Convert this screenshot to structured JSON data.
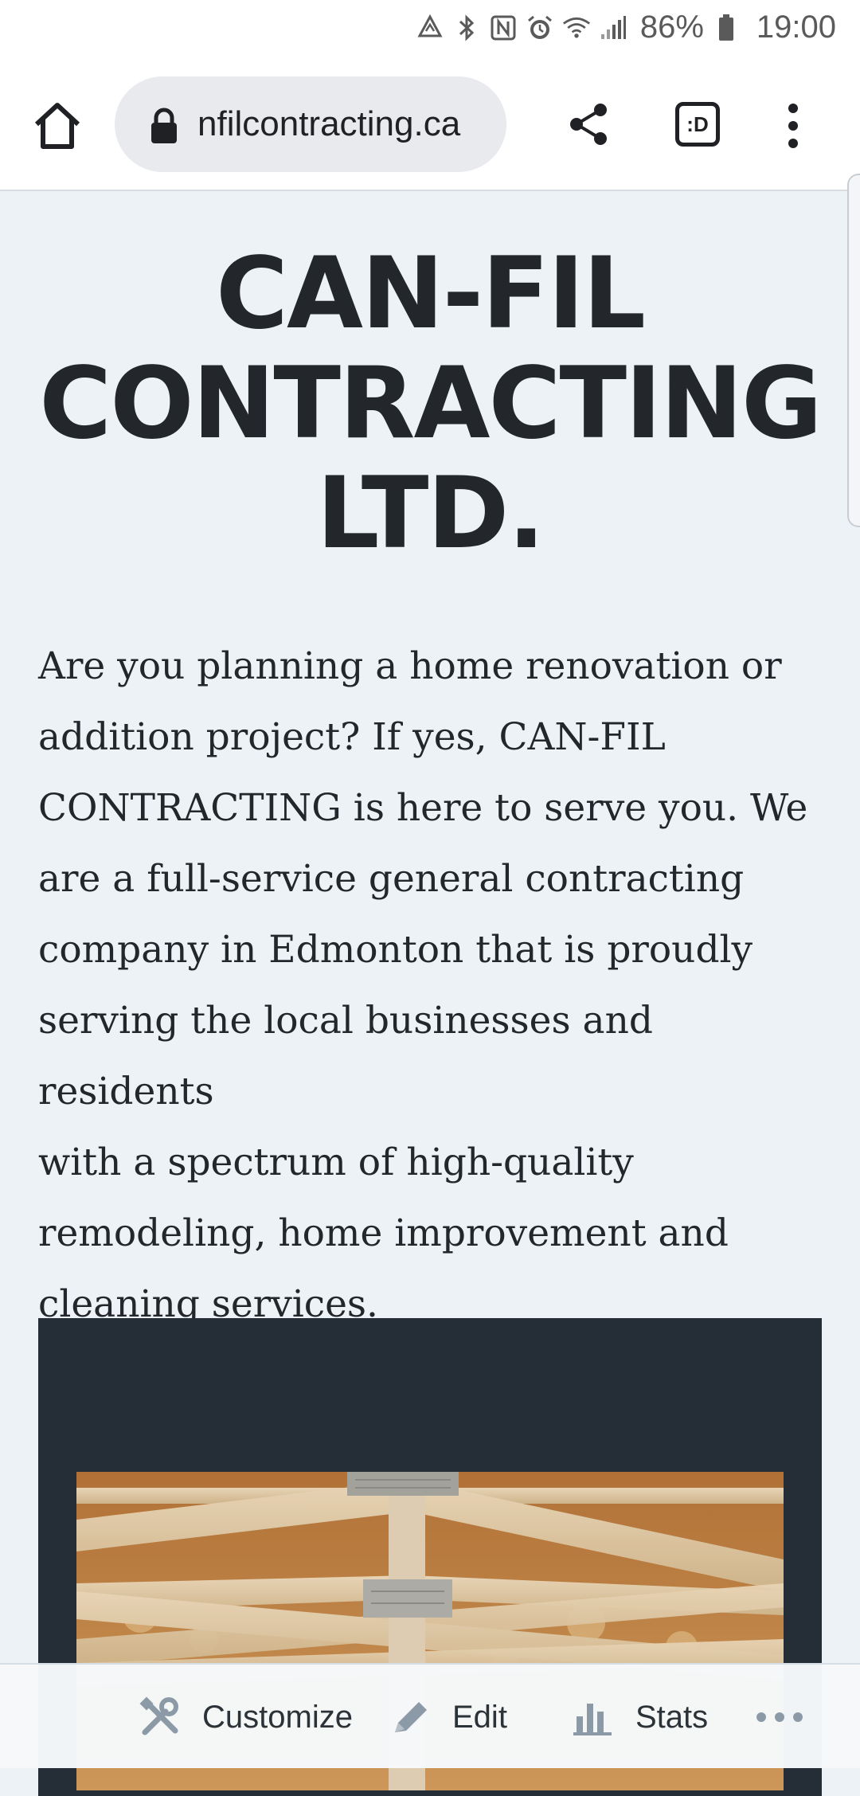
{
  "status_bar": {
    "battery_percent": "86%",
    "time": "19:00",
    "icons": [
      "sync-icon",
      "bluetooth-icon",
      "nfc-icon",
      "alarm-icon",
      "wifi-icon",
      "signal-icon",
      "battery-icon"
    ]
  },
  "browser": {
    "url": "nfilcontracting.ca",
    "tabs_label": ":D",
    "icons": [
      "home-icon",
      "lock-icon",
      "share-icon",
      "tab-switcher-icon",
      "overflow-menu-icon"
    ]
  },
  "page": {
    "title_lines": [
      "CAN-FIL",
      "CONTRACTING",
      "LTD."
    ],
    "intro_lines": [
      "Are you planning a home renovation or",
      "addition project? If yes, CAN-FIL",
      "CONTRACTING is here to serve you. We",
      "are a full-service general contracting",
      "company in Edmonton that is proudly",
      "serving the local businesses and residents",
      "with a spectrum of high-quality",
      "remodeling, home improvement and",
      "cleaning services."
    ]
  },
  "admin_bar": {
    "customize_label": "Customize",
    "edit_label": "Edit",
    "stats_label": "Stats",
    "more_label": "•••"
  },
  "colors": {
    "page_bg": "#edf2f7",
    "text": "#23272b",
    "dark_block": "#252d36",
    "admin_icon": "#8c9aa8"
  }
}
